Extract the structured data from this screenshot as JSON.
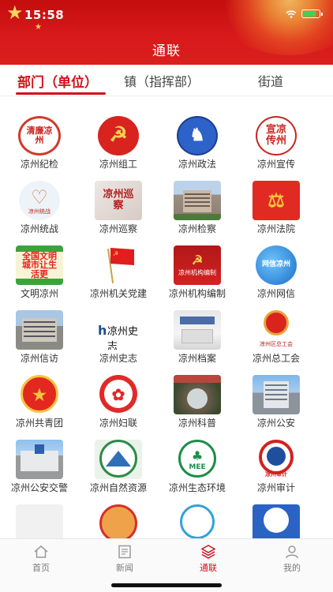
{
  "status_bar": {
    "time": "15:58"
  },
  "header": {
    "title": "通联"
  },
  "tabs": [
    {
      "label": "部门（单位）",
      "active": true
    },
    {
      "label": "镇（指挥部）",
      "active": false
    },
    {
      "label": "街道",
      "active": false
    }
  ],
  "grid": {
    "items": [
      {
        "label": "凉州纪检",
        "icon": "discipline-seal-icon",
        "icon_text": "清廉凉州"
      },
      {
        "label": "凉州组工",
        "icon": "party-emblem-icon",
        "icon_text": ""
      },
      {
        "label": "凉州政法",
        "icon": "bronze-horse-icon",
        "icon_text": ""
      },
      {
        "label": "凉州宣传",
        "icon": "publicity-seal-icon",
        "icon_text": "宣凉传州"
      },
      {
        "label": "凉州统战",
        "icon": "united-front-heart-icon",
        "icon_text": "凉州统战"
      },
      {
        "label": "凉州巡察",
        "icon": "inspection-logo-icon",
        "icon_text": "凉州巡察"
      },
      {
        "label": "凉州检察",
        "icon": "building-photo-icon",
        "icon_text": ""
      },
      {
        "label": "凉州法院",
        "icon": "court-emblem-icon",
        "icon_text": ""
      },
      {
        "label": "文明凉州",
        "icon": "civilized-city-banner-icon",
        "icon_text": "全国文明城市让生活更"
      },
      {
        "label": "凉州机关党建",
        "icon": "red-flag-icon",
        "icon_text": ""
      },
      {
        "label": "凉州机构编制",
        "icon": "organization-banner-icon",
        "icon_text": "凉州机构编制"
      },
      {
        "label": "凉州网信",
        "icon": "cyberspace-globe-icon",
        "icon_text": "网信凉州"
      },
      {
        "label": "凉州信访",
        "icon": "petition-building-icon",
        "icon_text": ""
      },
      {
        "label": "凉州史志",
        "icon": "history-logo-icon",
        "icon_text": "凉州史志"
      },
      {
        "label": "凉州档案",
        "icon": "archives-hall-icon",
        "icon_text": ""
      },
      {
        "label": "凉州总工会",
        "icon": "trade-union-emblem-icon",
        "icon_text": "凉州区总工会"
      },
      {
        "label": "凉州共青团",
        "icon": "youth-league-emblem-icon",
        "icon_text": ""
      },
      {
        "label": "凉州妇联",
        "icon": "womens-federation-emblem-icon",
        "icon_text": ""
      },
      {
        "label": "凉州科普",
        "icon": "science-crowd-photo-icon",
        "icon_text": ""
      },
      {
        "label": "凉州公安",
        "icon": "police-building-icon",
        "icon_text": ""
      },
      {
        "label": "凉州公安交警",
        "icon": "traffic-police-building-icon",
        "icon_text": ""
      },
      {
        "label": "凉州自然资源",
        "icon": "natural-resources-emblem-icon",
        "icon_text": ""
      },
      {
        "label": "凉州生态环境",
        "icon": "ecology-emblem-icon",
        "icon_text": "MEE"
      },
      {
        "label": "凉州审计",
        "icon": "audit-emblem-icon",
        "icon_text": "凉州审计"
      },
      {
        "label": "",
        "icon": "placeholder-image-icon",
        "icon_text": ""
      },
      {
        "label": "",
        "icon": "partial-emblem-icon",
        "icon_text": ""
      },
      {
        "label": "",
        "icon": "partial-emblem-icon",
        "icon_text": ""
      },
      {
        "label": "",
        "icon": "partial-emblem-icon",
        "icon_text": ""
      }
    ]
  },
  "bottom_nav": [
    {
      "label": "首页",
      "icon": "home-icon",
      "active": false
    },
    {
      "label": "新闻",
      "icon": "news-icon",
      "active": false
    },
    {
      "label": "通联",
      "icon": "layers-icon",
      "active": true
    },
    {
      "label": "我的",
      "icon": "user-icon",
      "active": false
    }
  ],
  "colors": {
    "brand_red": "#d0121b",
    "header_red": "#d7191a",
    "text": "#333333",
    "nav_inactive": "#7b7b7b"
  }
}
